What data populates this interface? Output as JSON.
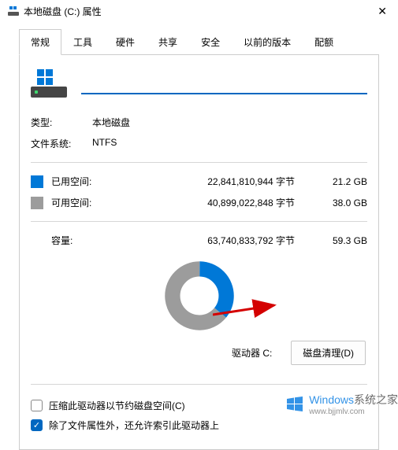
{
  "titlebar": {
    "title": "本地磁盘 (C:) 属性"
  },
  "tabs": {
    "items": [
      {
        "label": "常规"
      },
      {
        "label": "工具"
      },
      {
        "label": "硬件"
      },
      {
        "label": "共享"
      },
      {
        "label": "安全"
      },
      {
        "label": "以前的版本"
      },
      {
        "label": "配额"
      }
    ]
  },
  "drive": {
    "name_value": "",
    "type_label": "类型:",
    "type_value": "本地磁盘",
    "fs_label": "文件系统:",
    "fs_value": "NTFS",
    "drive_label": "驱动器 C:"
  },
  "space": {
    "used_label": "已用空间:",
    "used_bytes": "22,841,810,944 字节",
    "used_gb": "21.2 GB",
    "free_label": "可用空间:",
    "free_bytes": "40,899,022,848 字节",
    "free_gb": "38.0 GB",
    "cap_label": "容量:",
    "cap_bytes": "63,740,833,792 字节",
    "cap_gb": "59.3 GB"
  },
  "buttons": {
    "cleanup": "磁盘清理(D)"
  },
  "checkboxes": {
    "compress": "压缩此驱动器以节约磁盘空间(C)",
    "index": "除了文件属性外，还允许索引此驱动器上"
  },
  "chart_data": {
    "type": "pie",
    "title": "",
    "series": [
      {
        "name": "已用空间",
        "value": 22841810944,
        "color": "#0078d7"
      },
      {
        "name": "可用空间",
        "value": 40899022848,
        "color": "#9c9c9c"
      }
    ]
  },
  "watermark": {
    "brand": "Windows",
    "suffix": "系统之家",
    "url": "www.bjjmlv.com"
  }
}
